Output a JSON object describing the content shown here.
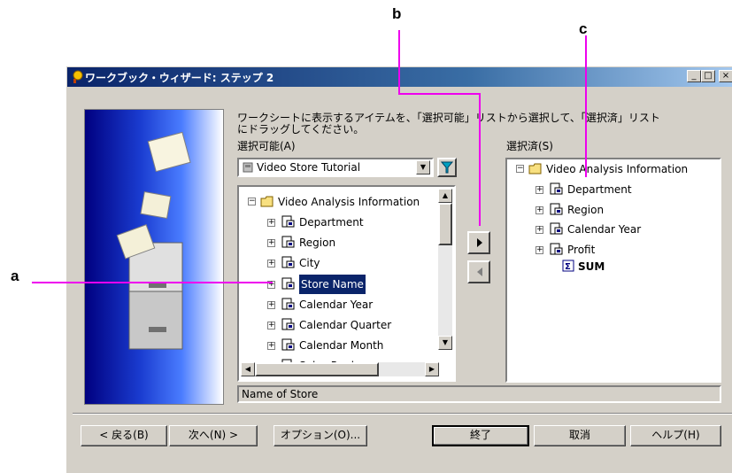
{
  "callouts": {
    "a": "a",
    "b": "b",
    "c": "c"
  },
  "window": {
    "title": "ワークブック・ウィザード: ステップ 2",
    "controls": [
      "_",
      "□",
      "×"
    ]
  },
  "instruction": {
    "line1": "ワークシートに表示するアイテムを、「選択可能」リストから選択して、「選択済」リスト",
    "line2": "にドラッグしてください。"
  },
  "available": {
    "label": "選択可能(A)",
    "dropdown_value": "Video Store Tutorial",
    "root": "Video Analysis Information",
    "items": [
      "Department",
      "Region",
      "City",
      "Store Name",
      "Calendar Year",
      "Calendar Quarter",
      "Calendar Month",
      "Sales Rank"
    ],
    "selected_item": "Store Name",
    "description": "Name of Store"
  },
  "selected": {
    "label": "選択済(S)",
    "root": "Video Analysis Information",
    "items": [
      "Department",
      "Region",
      "Calendar Year",
      "Profit"
    ],
    "sub_item": "SUM"
  },
  "buttons": {
    "back": "< 戻る(B)",
    "next": "次へ(N) >",
    "options": "オプション(O)...",
    "finish": "終了",
    "cancel": "取消",
    "help": "ヘルプ(H)"
  },
  "colors": {
    "callout_line": "#ee00ee",
    "title_bar": "#0a246a",
    "selection": "#0a246a",
    "dialog": "#d4d0c8"
  }
}
